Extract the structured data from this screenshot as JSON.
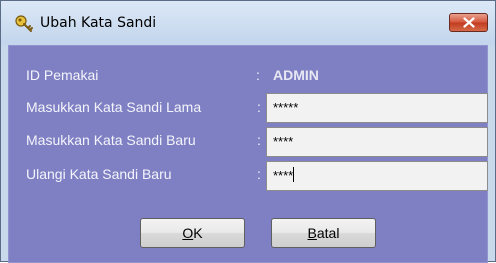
{
  "window": {
    "title": "Ubah Kata Sandi",
    "title_icon": "key-icon",
    "close_icon": "close-icon"
  },
  "form": {
    "user_id_label": "ID Pemakai",
    "user_id_value": "ADMIN",
    "old_password_label": "Masukkan Kata Sandi Lama",
    "old_password_value": "*****",
    "new_password_label": "Masukkan Kata Sandi Baru",
    "new_password_value": "****",
    "confirm_password_label": "Ulangi Kata Sandi Baru",
    "confirm_password_value": "****",
    "colon": ":"
  },
  "buttons": {
    "ok_mnemonic": "O",
    "ok_rest": "K",
    "cancel_mnemonic": "B",
    "cancel_rest": "atal"
  },
  "colors": {
    "panel_bg": "#7f80c3",
    "titlebar_bg": "#c9d9ec",
    "close_button": "#c23a1e"
  }
}
